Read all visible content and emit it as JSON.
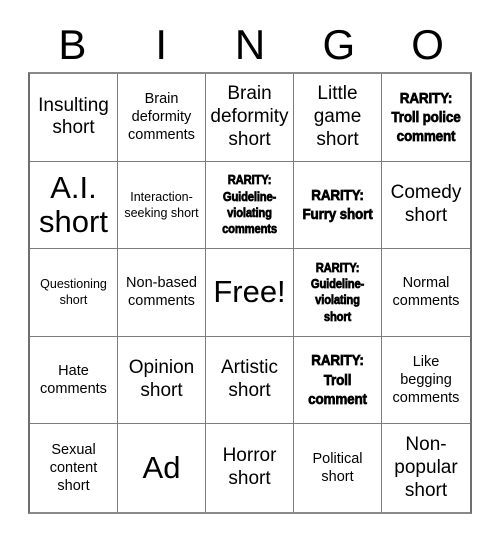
{
  "card": {
    "title": "BINGO card",
    "header_letters": [
      "B",
      "I",
      "N",
      "G",
      "O"
    ],
    "columns": 5,
    "rows": 5,
    "free_space_index": 12,
    "colors": {
      "background": "#ffffff",
      "text": "#000000",
      "grid_line": "#7d7d7d",
      "outer_border": "#6e6e6e"
    },
    "cells": [
      {
        "text": "Insulting short",
        "size": "md",
        "rarity": false
      },
      {
        "text": "Brain deformity comments",
        "size": "sm",
        "rarity": false
      },
      {
        "text": "Brain deformity short",
        "size": "md",
        "rarity": false
      },
      {
        "text": "Little game short",
        "size": "md",
        "rarity": false
      },
      {
        "text": "RARITY: Troll police comment",
        "size": "sm",
        "rarity": true
      },
      {
        "text": "A.I. short",
        "size": "xl",
        "rarity": false
      },
      {
        "text": "Interaction-seeking short",
        "size": "xs",
        "rarity": false
      },
      {
        "text": "RARITY: Guideline-violating comments",
        "size": "xs",
        "rarity": true
      },
      {
        "text": "RARITY: Furry short",
        "size": "sm",
        "rarity": true
      },
      {
        "text": "Comedy short",
        "size": "md",
        "rarity": false
      },
      {
        "text": "Questioning short",
        "size": "xs",
        "rarity": false
      },
      {
        "text": "Non-based comments",
        "size": "sm",
        "rarity": false
      },
      {
        "text": "Free!",
        "size": "xl",
        "rarity": false
      },
      {
        "text": "RARITY: Guideline-violating short",
        "size": "xs",
        "rarity": true
      },
      {
        "text": "Normal comments",
        "size": "sm",
        "rarity": false
      },
      {
        "text": "Hate comments",
        "size": "sm",
        "rarity": false
      },
      {
        "text": "Opinion short",
        "size": "md",
        "rarity": false
      },
      {
        "text": "Artistic short",
        "size": "md",
        "rarity": false
      },
      {
        "text": "RARITY: Troll comment",
        "size": "sm",
        "rarity": true
      },
      {
        "text": "Like begging comments",
        "size": "sm",
        "rarity": false
      },
      {
        "text": "Sexual content short",
        "size": "sm",
        "rarity": false
      },
      {
        "text": "Ad",
        "size": "xl",
        "rarity": false
      },
      {
        "text": "Horror short",
        "size": "md",
        "rarity": false
      },
      {
        "text": "Political short",
        "size": "sm",
        "rarity": false
      },
      {
        "text": "Non-popular short",
        "size": "md",
        "rarity": false
      }
    ]
  }
}
